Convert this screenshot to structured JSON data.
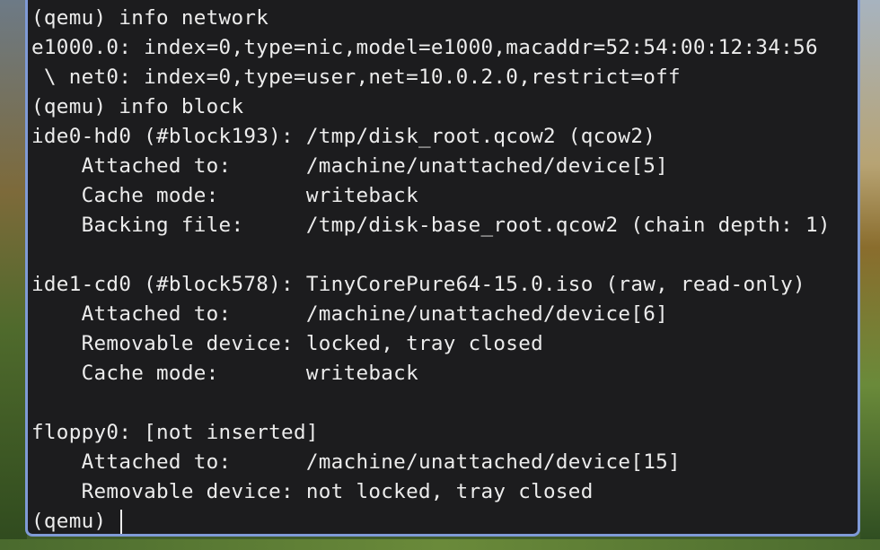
{
  "colors": {
    "terminal_background": "#1c1c1e",
    "terminal_text": "#ececec",
    "window_border": "#7f9ad6"
  },
  "terminal": {
    "lines": [
      "(qemu) info network",
      "e1000.0: index=0,type=nic,model=e1000,macaddr=52:54:00:12:34:56",
      " \\ net0: index=0,type=user,net=10.0.2.0,restrict=off",
      "(qemu) info block",
      "ide0-hd0 (#block193): /tmp/disk_root.qcow2 (qcow2)",
      "    Attached to:      /machine/unattached/device[5]",
      "    Cache mode:       writeback",
      "    Backing file:     /tmp/disk-base_root.qcow2 (chain depth: 1)",
      "",
      "ide1-cd0 (#block578): TinyCorePure64-15.0.iso (raw, read-only)",
      "    Attached to:      /machine/unattached/device[6]",
      "    Removable device: locked, tray closed",
      "    Cache mode:       writeback",
      "",
      "floppy0: [not inserted]",
      "    Attached to:      /machine/unattached/device[15]",
      "    Removable device: not locked, tray closed"
    ],
    "prompt": "(qemu) "
  }
}
